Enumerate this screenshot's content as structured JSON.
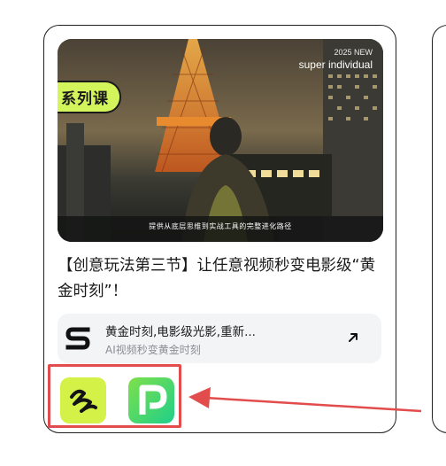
{
  "banner": {
    "badge": "系列课",
    "year_tag": "2025 NEW",
    "brand": "super individual",
    "caption": "提供从底层思维到实战工具的完整进化路径"
  },
  "title": "【创意玩法第三节】让任意视频秒变电影级“黄金时刻”！",
  "link": {
    "title": "黄金时刻,电影级光影,重新...",
    "subtitle": "AI视频秒变黄金时刻"
  },
  "tools": [
    {
      "name": "tool-app-1"
    },
    {
      "name": "tool-app-2"
    }
  ],
  "colors": {
    "badge": "#d4f45c",
    "annotation": "#e24c4c",
    "link_bg": "#f3f4f6"
  }
}
